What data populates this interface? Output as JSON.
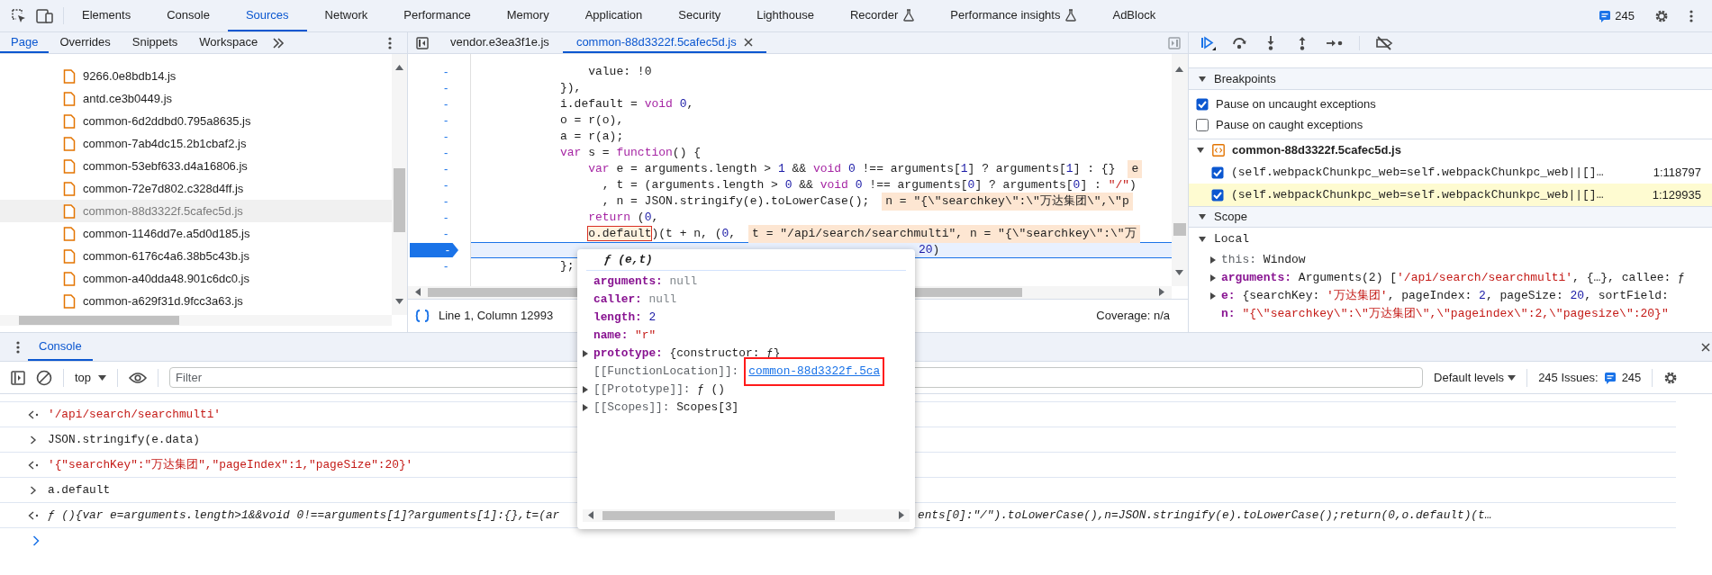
{
  "top_tabs": [
    {
      "label": "Elements",
      "selected": false,
      "experimental": false
    },
    {
      "label": "Console",
      "selected": false,
      "experimental": false
    },
    {
      "label": "Sources",
      "selected": true,
      "experimental": false
    },
    {
      "label": "Network",
      "selected": false,
      "experimental": false
    },
    {
      "label": "Performance",
      "selected": false,
      "experimental": false
    },
    {
      "label": "Memory",
      "selected": false,
      "experimental": false
    },
    {
      "label": "Application",
      "selected": false,
      "experimental": false
    },
    {
      "label": "Security",
      "selected": false,
      "experimental": false
    },
    {
      "label": "Lighthouse",
      "selected": false,
      "experimental": false
    },
    {
      "label": "Recorder",
      "selected": false,
      "experimental": true
    },
    {
      "label": "Performance insights",
      "selected": false,
      "experimental": true
    },
    {
      "label": "AdBlock",
      "selected": false,
      "experimental": false
    }
  ],
  "issues_badge": "245",
  "navigator": {
    "tabs": [
      {
        "label": "Page",
        "selected": true
      },
      {
        "label": "Overrides",
        "selected": false
      },
      {
        "label": "Snippets",
        "selected": false
      },
      {
        "label": "Workspace",
        "selected": false
      }
    ],
    "files": [
      {
        "name": "9266.0e8bdb14.js",
        "selected": false
      },
      {
        "name": "antd.ce3b0449.js",
        "selected": false
      },
      {
        "name": "common-6d2ddbd0.795a8635.js",
        "selected": false
      },
      {
        "name": "common-7ab4dc15.2b1cbaf2.js",
        "selected": false
      },
      {
        "name": "common-53ebf633.d4a16806.js",
        "selected": false
      },
      {
        "name": "common-72e7d802.c328d4ff.js",
        "selected": false
      },
      {
        "name": "common-88d3322f.5cafec5d.js",
        "selected": true
      },
      {
        "name": "common-1146dd7e.a5d0d185.js",
        "selected": false
      },
      {
        "name": "common-6176c4a6.38b5c43b.js",
        "selected": false
      },
      {
        "name": "common-a40dda48.901c6dc0.js",
        "selected": false
      },
      {
        "name": "common-a629f31d.9fcc3a63.js",
        "selected": false
      }
    ]
  },
  "editor": {
    "tabs": [
      {
        "label": "vendor.e3ea3f1e.js",
        "selected": false
      },
      {
        "label": "common-88d3322f.5cafec5d.js",
        "selected": true
      }
    ],
    "lines": [
      {
        "gutter": "-",
        "paused": false,
        "segments": [
          {
            "kind": "plain",
            "text": "    value: !0"
          }
        ]
      },
      {
        "gutter": "-",
        "paused": false,
        "segments": [
          {
            "kind": "plain",
            "text": "}),"
          }
        ]
      },
      {
        "gutter": "-",
        "paused": false,
        "segments": [
          {
            "kind": "plain",
            "text": "i.default = "
          },
          {
            "kind": "keyword",
            "text": "void"
          },
          {
            "kind": "number",
            "text": " 0"
          },
          {
            "kind": "plain",
            "text": ","
          }
        ]
      },
      {
        "gutter": "-",
        "paused": false,
        "segments": [
          {
            "kind": "plain",
            "text": "o = r(o),"
          }
        ]
      },
      {
        "gutter": "-",
        "paused": false,
        "segments": [
          {
            "kind": "plain",
            "text": "a = r(a);"
          }
        ]
      },
      {
        "gutter": "-",
        "paused": false,
        "segments": [
          {
            "kind": "keyword",
            "text": "var"
          },
          {
            "kind": "plain",
            "text": " s = "
          },
          {
            "kind": "keyword",
            "text": "function"
          },
          {
            "kind": "plain",
            "text": "() {"
          }
        ]
      },
      {
        "gutter": "-",
        "paused": false,
        "segments": [
          {
            "kind": "keyword",
            "text": "    var"
          },
          {
            "kind": "plain",
            "text": " e = arguments.length > "
          },
          {
            "kind": "number",
            "text": "1"
          },
          {
            "kind": "plain",
            "text": " && "
          },
          {
            "kind": "keyword",
            "text": "void"
          },
          {
            "kind": "number",
            "text": " 0"
          },
          {
            "kind": "plain",
            "text": " !== arguments["
          },
          {
            "kind": "number",
            "text": "1"
          },
          {
            "kind": "plain",
            "text": "] ? arguments["
          },
          {
            "kind": "number",
            "text": "1"
          },
          {
            "kind": "plain",
            "text": "] : {}"
          }
        ],
        "inline_value": "e"
      },
      {
        "gutter": "-",
        "paused": false,
        "segments": [
          {
            "kind": "plain",
            "text": "      , t = (arguments.length > "
          },
          {
            "kind": "number",
            "text": "0"
          },
          {
            "kind": "plain",
            "text": " && "
          },
          {
            "kind": "keyword",
            "text": "void"
          },
          {
            "kind": "number",
            "text": " 0"
          },
          {
            "kind": "plain",
            "text": " !== arguments["
          },
          {
            "kind": "number",
            "text": "0"
          },
          {
            "kind": "plain",
            "text": "] ? arguments["
          },
          {
            "kind": "number",
            "text": "0"
          },
          {
            "kind": "plain",
            "text": "] : "
          },
          {
            "kind": "string",
            "text": "\"/\""
          },
          {
            "kind": "plain",
            "text": ")"
          }
        ]
      },
      {
        "gutter": "-",
        "paused": false,
        "segments": [
          {
            "kind": "plain",
            "text": "      , n = JSON.stringify(e).toLowerCase();"
          }
        ],
        "inline_value": "n = \"{\\\"searchkey\\\":\\\"万达集团\\\",\\\"p"
      },
      {
        "gutter": "-",
        "paused": false,
        "segments": [
          {
            "kind": "keyword",
            "text": "    return"
          },
          {
            "kind": "plain",
            "text": " ("
          },
          {
            "kind": "number",
            "text": "0"
          },
          {
            "kind": "plain",
            "text": ","
          }
        ]
      },
      {
        "gutter": "-",
        "paused": false,
        "segments": [
          {
            "kind": "hover",
            "text": "    o.default"
          },
          {
            "kind": "plain",
            "text": ")(t + n, ("
          },
          {
            "kind": "number",
            "text": "0"
          },
          {
            "kind": "plain",
            "text": ","
          }
        ],
        "inline_value": "t = \"/api/search/searchmulti\", n = \"{\\\"searchkey\\\":\\\"万"
      },
      {
        "gutter": "-",
        "paused": true,
        "segments": [
          {
            "kind": "number",
            "text": "20"
          },
          {
            "kind": "plain",
            "text": ")"
          }
        ]
      },
      {
        "gutter": "-",
        "paused": false,
        "segments": [
          {
            "kind": "plain",
            "text": "};"
          }
        ]
      }
    ],
    "status": {
      "position": "Line 1, Column 12993",
      "coverage": "Coverage: n/a"
    }
  },
  "debugger": {
    "breakpoints": {
      "title": "Breakpoints",
      "expanded": true,
      "pause_options": [
        {
          "label": "Pause on uncaught exceptions",
          "checked": true
        },
        {
          "label": "Pause on caught exceptions",
          "checked": false
        }
      ],
      "file": {
        "name": "common-88d3322f.5cafec5d.js",
        "expanded": true
      },
      "items": [
        {
          "code": "(self.webpackChunkpc_web=self.webpackChunkpc_web||[]…",
          "location": "1:118797",
          "checked": true,
          "selected": false
        },
        {
          "code": "(self.webpackChunkpc_web=self.webpackChunkpc_web||[]…",
          "location": "1:129935",
          "checked": true,
          "selected": true
        }
      ]
    },
    "scope": {
      "title": "Scope",
      "expanded": true,
      "local": {
        "label": "Local",
        "expanded": true,
        "children": [
          {
            "key": "this:",
            "expandable": true,
            "own": false,
            "segments": [
              {
                "kind": "plain",
                "text": "Window"
              }
            ]
          },
          {
            "key": "arguments:",
            "expandable": true,
            "own": true,
            "segments": [
              {
                "kind": "plain",
                "text": "Arguments(2) ["
              },
              {
                "kind": "string",
                "text": "'/api/search/searchmulti'"
              },
              {
                "kind": "plain",
                "text": ", {…}, callee: ƒ"
              }
            ]
          },
          {
            "key": "e:",
            "expandable": true,
            "own": true,
            "segments": [
              {
                "kind": "plain",
                "text": "{searchKey: "
              },
              {
                "kind": "string",
                "text": "'万达集团'"
              },
              {
                "kind": "plain",
                "text": ", pageIndex: "
              },
              {
                "kind": "number",
                "text": "2"
              },
              {
                "kind": "plain",
                "text": ", pageSize: "
              },
              {
                "kind": "number",
                "text": "20"
              },
              {
                "kind": "plain",
                "text": ", sortField:"
              }
            ]
          },
          {
            "key": "n:",
            "expandable": false,
            "own": true,
            "segments": [
              {
                "kind": "string",
                "text": "\"{\\\"searchkey\\\":\\\"万达集团\\\",\\\"pageindex\\\":2,\\\"pagesize\\\":20}\""
              }
            ]
          }
        ]
      }
    }
  },
  "console": {
    "tab": {
      "label": "Console",
      "selected": true
    },
    "context": "top",
    "filter_placeholder": "Filter",
    "levels": "Default levels",
    "issues_label": "245 Issues:",
    "issues_count": "245",
    "entries": [
      {
        "kind": "result",
        "segments": [
          {
            "kind": "string",
            "text": "'/api/search/searchmulti'"
          }
        ]
      },
      {
        "kind": "input",
        "segments": [
          {
            "kind": "plain",
            "text": "JSON.stringify(e.data)"
          }
        ]
      },
      {
        "kind": "result",
        "segments": [
          {
            "kind": "string",
            "text": "'{\"searchKey\":\"万达集团\",\"pageIndex\":1,\"pageSize\":20}'"
          }
        ]
      },
      {
        "kind": "input",
        "segments": [
          {
            "kind": "plain",
            "text": "a.default"
          }
        ]
      },
      {
        "kind": "function",
        "segments": [
          {
            "kind": "italic",
            "text": "ƒ (){var e=arguments.length>1&&void 0!==arguments[1]?arguments[1]:{},t=(ar"
          },
          {
            "kind": "italic",
            "text": "ents[0]:\"/\").toLowerCase(),n=JSON.stringify(e).toLowerCase();return(0,o.default)(t…"
          }
        ]
      }
    ]
  },
  "popover": {
    "signature": "ƒ (e,t)",
    "properties": [
      {
        "key": "arguments:",
        "own": true,
        "expandable": false,
        "kind": "null",
        "value": "null"
      },
      {
        "key": "caller:",
        "own": true,
        "expandable": false,
        "kind": "null",
        "value": "null"
      },
      {
        "key": "length:",
        "own": true,
        "expandable": false,
        "kind": "number",
        "value": "2"
      },
      {
        "key": "name:",
        "own": true,
        "expandable": false,
        "kind": "string",
        "value": "\"r\""
      },
      {
        "key": "prototype:",
        "own": true,
        "expandable": true,
        "kind": "plain",
        "value": "{constructor: ƒ}"
      },
      {
        "key": "[[FunctionLocation]]:",
        "own": false,
        "expandable": false,
        "kind": "link",
        "value": "common-88d3322f.5ca",
        "marked": true
      },
      {
        "key": "[[Prototype]]:",
        "own": false,
        "expandable": true,
        "kind": "plain",
        "value": "ƒ ()"
      },
      {
        "key": "[[Scopes]]:",
        "own": false,
        "expandable": true,
        "kind": "plain",
        "value": "Scopes[3]"
      }
    ]
  }
}
